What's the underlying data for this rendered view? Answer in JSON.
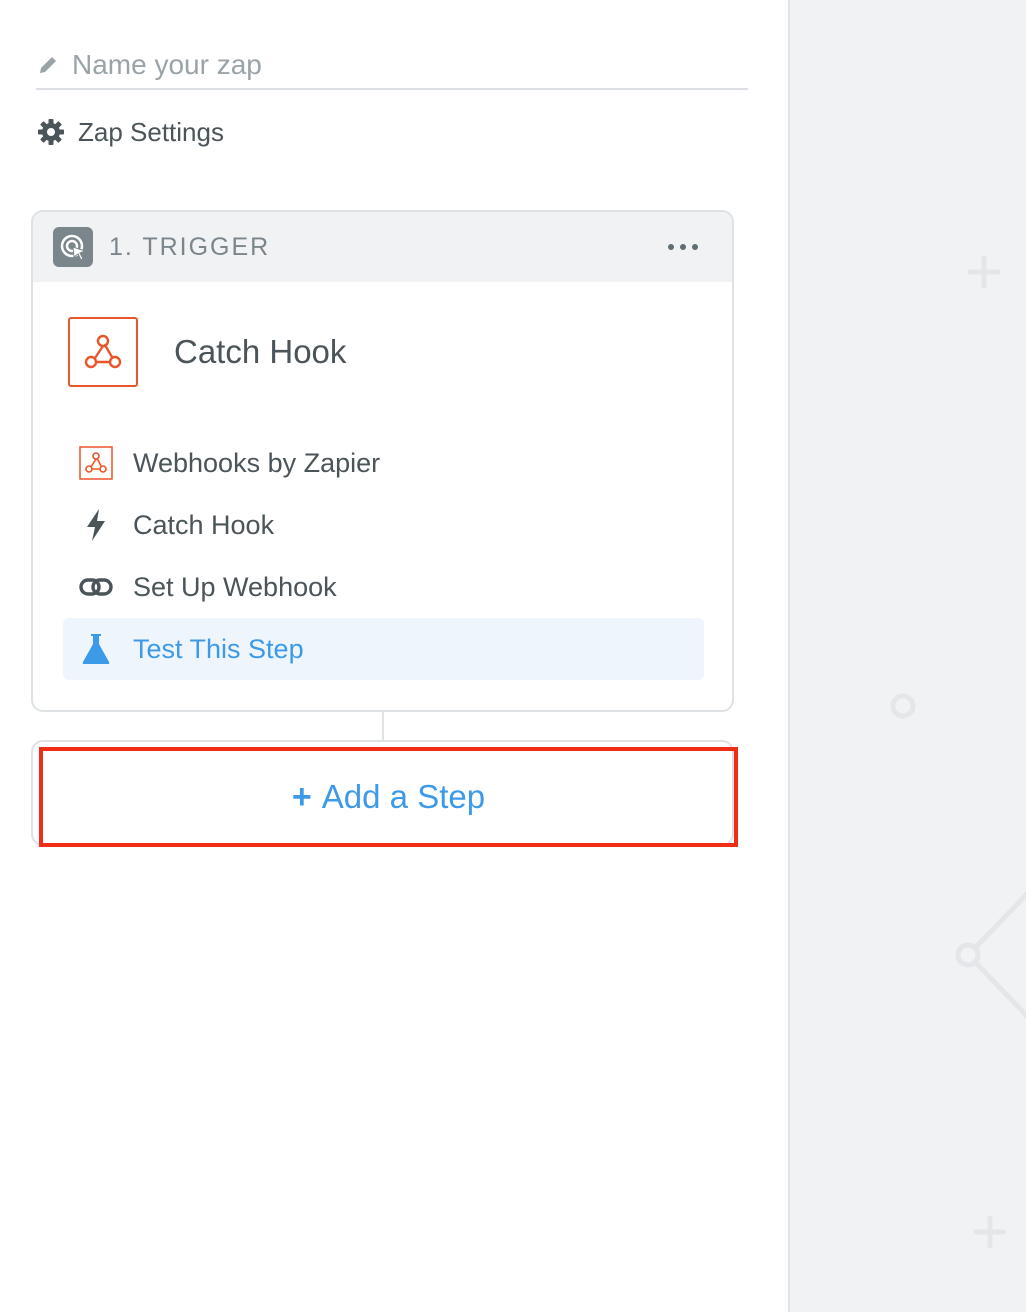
{
  "zap_name": {
    "placeholder": "Name your zap",
    "value": ""
  },
  "settings": {
    "label": "Zap Settings"
  },
  "trigger": {
    "title": "1. TRIGGER",
    "app_event_title": "Catch Hook",
    "steps": [
      {
        "label": "Webhooks by Zapier",
        "icon": "webhook-icon"
      },
      {
        "label": "Catch Hook",
        "icon": "lightning-icon"
      },
      {
        "label": "Set Up Webhook",
        "icon": "link-icon"
      },
      {
        "label": "Test This Step",
        "icon": "flask-icon",
        "active": true
      }
    ]
  },
  "add_step": {
    "plus": "+",
    "label": "Add a Step"
  },
  "colors": {
    "accent_blue": "#3d9ae8",
    "webhook_orange": "#e8562a",
    "highlight_red": "#f02e17",
    "canvas_bg": "#f1f2f4"
  }
}
